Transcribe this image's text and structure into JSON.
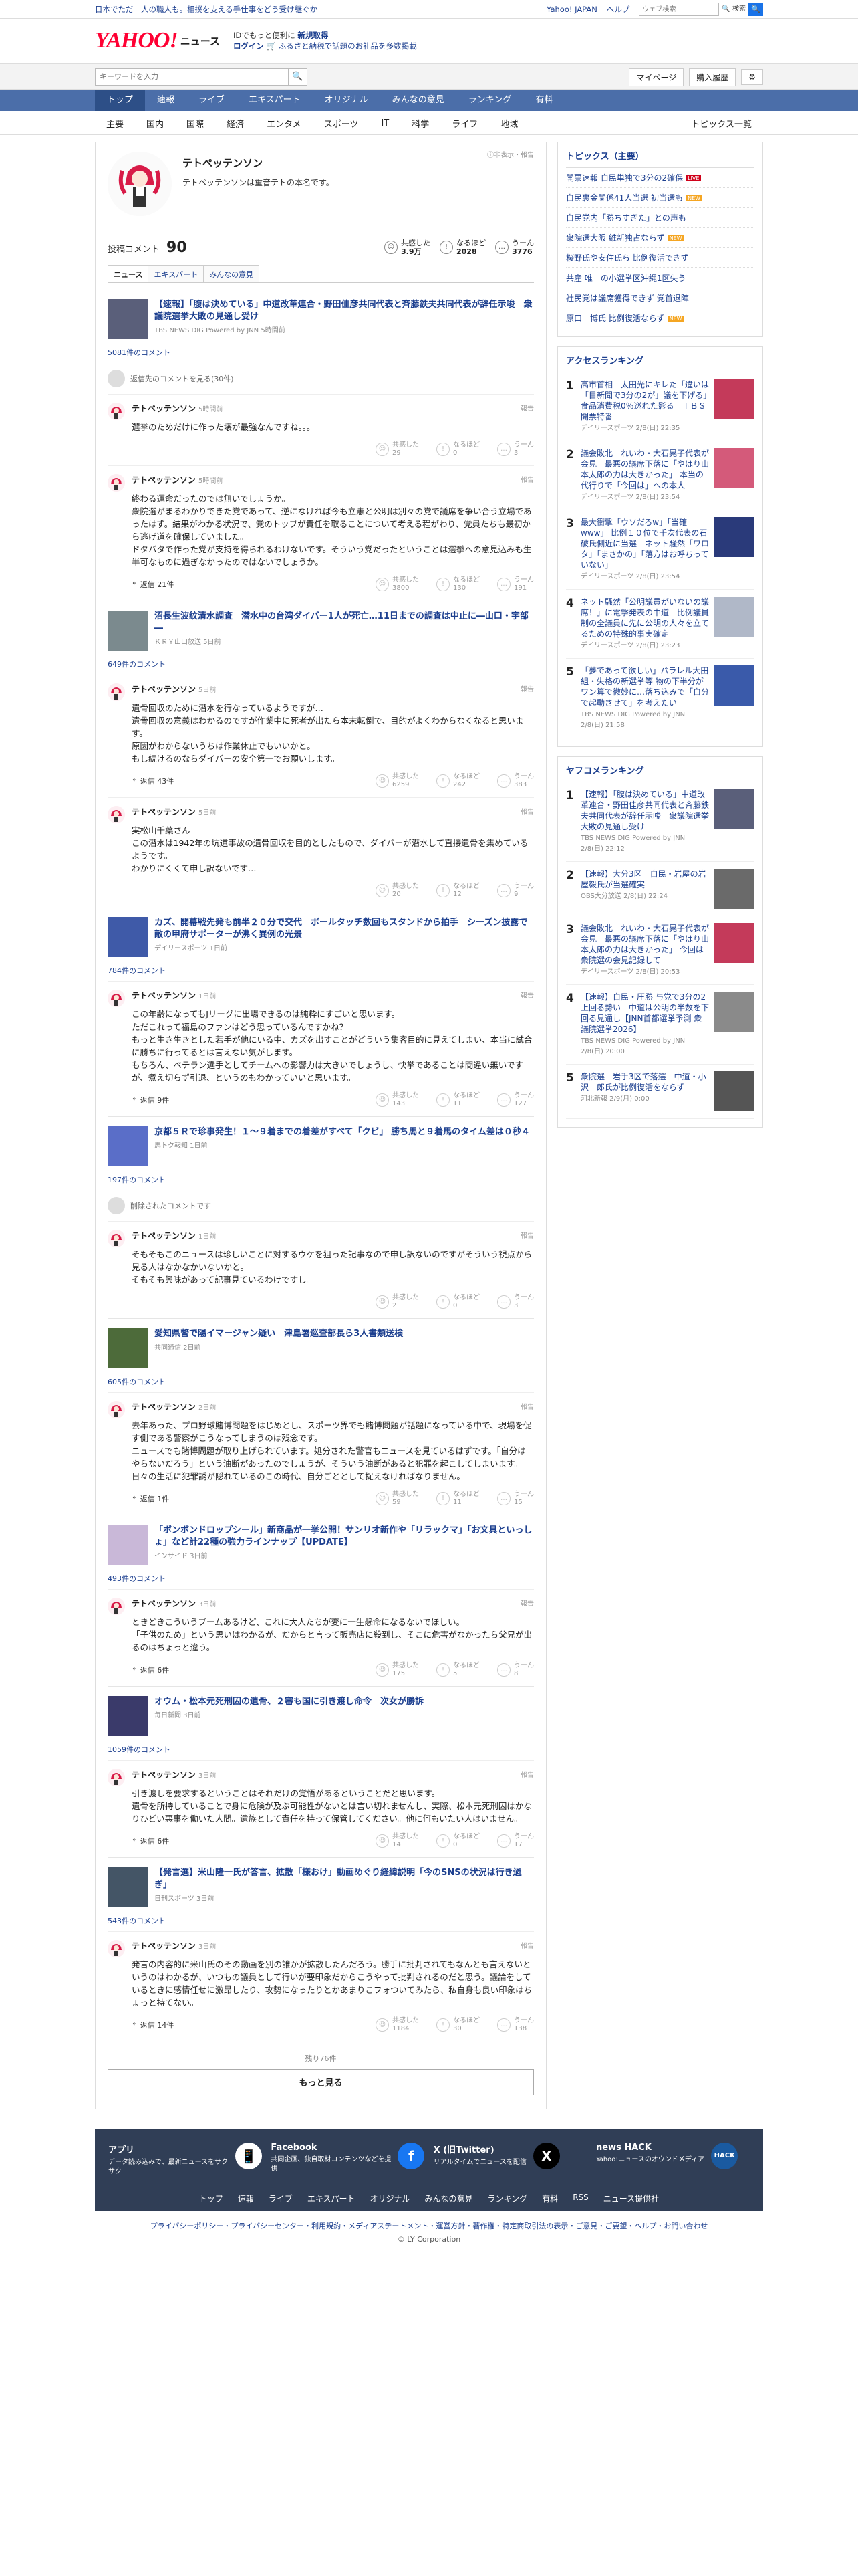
{
  "promo": {
    "left": "日本でただ一人の職人も。相撲を支える手仕事をどう受け継ぐか",
    "links": [
      "Yahoo! JAPAN",
      "ヘルプ"
    ],
    "search_placeholder": "ウェブ検索",
    "search_label": "🔍 検索"
  },
  "header": {
    "logo": "YAHOO!",
    "logo_sub": "ニュース",
    "msg1": "IDでもっと便利に",
    "msg1_bold": "新規取得",
    "msg2": "ログイン",
    "msg2_rest": "🛒 ふるさと納税で話題のお礼品を多数掲載"
  },
  "search": {
    "placeholder": "キーワードを入力",
    "mypage": "マイページ",
    "history": "購入履歴"
  },
  "main_nav": [
    "トップ",
    "速報",
    "ライブ",
    "エキスパート",
    "オリジナル",
    "みんなの意見",
    "ランキング",
    "有料"
  ],
  "cat_nav": [
    "主要",
    "国内",
    "国際",
    "経済",
    "エンタメ",
    "スポーツ",
    "IT",
    "科学",
    "ライフ",
    "地域",
    "トピックス一覧"
  ],
  "profile": {
    "name": "テトペッテンソン",
    "bio": "テトペッテンソンは重音テトの本名です。",
    "report": "ⓘ非表示・報告",
    "comments_label": "投稿コメント",
    "comments_count": "90",
    "reactions": [
      {
        "label": "共感した",
        "value": "3.9万",
        "icon": "☺"
      },
      {
        "label": "なるほど",
        "value": "2028",
        "icon": "!"
      },
      {
        "label": "うーん",
        "value": "3776",
        "icon": "…"
      }
    ],
    "tabs": [
      "ニュース",
      "エキスパート",
      "みんなの意見"
    ]
  },
  "blocks": [
    {
      "title": "【速報】「腹は決めている」中道改革連合・野田佳彦共同代表と斉藤鉄夫共同代表が辞任示唆　衆議院選挙大敗の見通し受け",
      "source": "TBS NEWS DIG Powered by JNN 5時間前",
      "comment_count": "5081件のコメント",
      "thumb_color": "#5a5f7a",
      "hidden": "返信先のコメントを見る(30件)",
      "comments": [
        {
          "name": "テトペッテンソン",
          "time": "5時間前",
          "text": "選挙のためだけに作った壊が最強なんですね。。。",
          "reply": "",
          "r": [
            "29",
            "0",
            "3"
          ]
        },
        {
          "name": "テトペッテンソン",
          "time": "5時間前",
          "text": "終わる運命だったのでは無いでしょうか。\n衆院選がまるわかりできた党であって、逆になければ今も立憲と公明は別々の党で議席を争い合う立場であったはず。結果がわかる状況で、党のトップが責任を取ることについて考える程がわり、党員たちも最初から逃げ道を確保していました。\nドタバタで作った党が支持を得られるわけないです。そういう党だったということは選挙への意見込みも生半可なものに過ぎなかったのではないでしょうか。",
          "reply": "返信 21件",
          "r": [
            "3800",
            "130",
            "191"
          ]
        }
      ]
    },
    {
      "title": "沼長生波紋清水調査　潜水中の台湾ダイバー1人が死亡…11日までの調査は中止に―山口・宇部―",
      "source": "ＫＲＹ山口放送 5日前",
      "comment_count": "649件のコメント",
      "thumb_color": "#7b8a8e",
      "hidden": "",
      "comments": [
        {
          "name": "テトペッテンソン",
          "time": "5日前",
          "text": "遺骨回収のために潜水を行なっているようですが…\n遺骨回収の意義はわかるのですが作業中に死者が出たら本末転倒で、目的がよくわからなくなると思います。\n原因がわからないうちは作業休止でもいいかと。\nもし続けるのならダイバーの安全第一でお願いします。",
          "reply": "返信 43件",
          "r": [
            "6259",
            "242",
            "383"
          ]
        },
        {
          "name": "テトペッテンソン",
          "time": "5日前",
          "text": "実松山千葉さん\nこの潜水は1942年の坑道事故の遺骨回収を目的としたもので、ダイバーが潜水して直接遺骨を集めているようです。\nわかりにくくて申し訳ないです…",
          "reply": "",
          "r": [
            "20",
            "12",
            "9"
          ]
        }
      ]
    },
    {
      "title": "カズ、開幕戦先発も前半２０分で交代　ボールタッチ数回もスタンドから拍手　シーズン披露で敵の甲府サポーターが沸く異例の光景",
      "source": "デイリースポーツ 1日前",
      "comment_count": "784件のコメント",
      "thumb_color": "#3f5aa8",
      "hidden": "",
      "comments": [
        {
          "name": "テトペッテンソン",
          "time": "1日前",
          "text": "この年齢になってもJリーグに出場できるのは純粋にすごいと思います。\nただこれって福島のファンはどう思っているんですかね？\nもっと生き生きとした若手が他にいる中、カズを出すことがどういう集客目的に見えてしまい、本当に試合に勝ちに行ってるとは言えない気がします。\nもちろん、ベテラン選手としてチームへの影響力は大きいでしょうし、快挙であることは間違い無いですが、煮え切らず引退、というのもわかっていいと思います。",
          "reply": "返信 9件",
          "r": [
            "143",
            "11",
            "127"
          ]
        }
      ]
    },
    {
      "title": "京都５Ｒで珍事発生！１～９着までの着差がすべて「クビ」 勝ち馬と９着馬のタイム差は０秒４",
      "source": "馬トク報知 1日前",
      "comment_count": "197件のコメント",
      "thumb_color": "#5a6ec8",
      "hidden": "削除されたコメントです",
      "comments": [
        {
          "name": "テトペッテンソン",
          "time": "1日前",
          "text": "そもそもこのニュースは珍しいことに対するウケを狙った記事なので申し訳ないのですがそういう視点から見る人はなかなかいないかと。\nそもそも興味があって記事見ているわけですし。",
          "reply": "",
          "r": [
            "2",
            "0",
            "3"
          ]
        }
      ]
    },
    {
      "title": "愛知県警で陽イマージャン疑い　津島署巡査部長ら3人書類送検",
      "source": "共同通信 2日前",
      "comment_count": "605件のコメント",
      "thumb_color": "#4d6b3a",
      "hidden": "",
      "comments": [
        {
          "name": "テトペッテンソン",
          "time": "2日前",
          "text": "去年あった、プロ野球賭博問題をはじめとし、スポーツ界でも賭博問題が話題になっている中で、現場を促す側である警察がこうなってしまうのは残念です。\nニュースでも賭博問題が取り上げられています。処分された警官もニュースを見ているはずです。「自分はやらないだろう」という油断があったのでしょうが、そういう油断があると犯罪を起こしてしまいます。日々の生活に犯罪誘が隠れているのこの時代、自分ごととして捉えなければなりません。",
          "reply": "返信 1件",
          "r": [
            "59",
            "11",
            "15"
          ]
        }
      ]
    },
    {
      "title": "「ボンボンドロップシール」新商品が一挙公開！サンリオ新作や「リラックマ」「お文具といっしょ」など計22種の強力ラインナップ【UPDATE】",
      "source": "インサイド 3日前",
      "comment_count": "493件のコメント",
      "thumb_color": "#c9b8d8",
      "hidden": "",
      "comments": [
        {
          "name": "テトペッテンソン",
          "time": "3日前",
          "text": "ときどきこういうブームあるけど、これに大人たちが変に一生懸命になるないでほしい。\n「子供のため」という思いはわかるが、だからと言って販売店に殺到し、そこに危害がなかったら父兄が出るのはちょっと違う。",
          "reply": "返信 6件",
          "r": [
            "175",
            "5",
            "8"
          ]
        }
      ]
    },
    {
      "title": "オウム・松本元死刑囚の遺骨、２審も国に引き渡し命令　次女が勝訴",
      "source": "毎日新聞 3日前",
      "comment_count": "1059件のコメント",
      "thumb_color": "#3a3a6a",
      "hidden": "",
      "comments": [
        {
          "name": "テトペッテンソン",
          "time": "3日前",
          "text": "引き渡しを要求するということはそれだけの覚悟があるということだと思います。\n遺骨を所持していることで身に危険が及ぶ可能性がないとは言い切れませんし、実際、松本元死刑囚はかなりひどい悪事を働いた人間。遺族として責任を持って保管してください。他に何もいたい人はいません。",
          "reply": "返信 6件",
          "r": [
            "14",
            "0",
            "17"
          ]
        }
      ]
    },
    {
      "title": "【発言選】米山隆一氏が答言、拡散「様おけ」動画めぐり経緯説明「今のSNSの状況は行き過ぎ」",
      "source": "日刊スポーツ 3日前",
      "comment_count": "543件のコメント",
      "thumb_color": "#445566",
      "hidden": "",
      "comments": [
        {
          "name": "テトペッテンソン",
          "time": "3日前",
          "text": "発言の内容的に米山氏のその動画を別の誰かが拡散したんだろう。勝手に批判されてもなんとも言えないというのはわかるが、いつもの議員として行いが要印象だからこうやって批判されるのだと思う。議論をしているときに感情任せに激昂したり、攻勢になったりとかあまりこフォついてみたら、私自身も良い印象はちょっと持てない。",
          "reply": "返信 14件",
          "r": [
            "1184",
            "30",
            "138"
          ]
        }
      ]
    }
  ],
  "more_count": "残り76件",
  "more_button": "もっと見る",
  "sidebar": {
    "topics_header": "トピックス（主要）",
    "topics": [
      {
        "t": "開票速報 自民単独で3分の2確保",
        "b": "LIVE",
        "c": "#d0021b"
      },
      {
        "t": "自民裏金関係41人当選 初当選も",
        "b": "NEW",
        "c": "#f5a623"
      },
      {
        "t": "自民党内「勝ちすぎた」との声も",
        "b": "",
        "c": ""
      },
      {
        "t": "衆院選大阪 維新独占ならず",
        "b": "NEW",
        "c": "#f5a623"
      },
      {
        "t": "桜野氏や安住氏ら 比例復活できず",
        "b": "",
        "c": ""
      },
      {
        "t": "共産 唯一の小選挙区沖縄1区失う",
        "b": "",
        "c": ""
      },
      {
        "t": "社民党は議席獲得できず 党首退陣",
        "b": "",
        "c": ""
      },
      {
        "t": "原口一博氏 比例復活ならず",
        "b": "NEW",
        "c": "#f5a623"
      }
    ],
    "access_header": "アクセスランキング",
    "access": [
      {
        "t": "高市首相　太田光にキレた「違いは「目新聞で3分の2が」議を下げる」食品消費税0％巡れた影る　ＴＢＳ開票特番",
        "s": "デイリースポーツ 2/8(日) 22:35",
        "c": "#c43a5a"
      },
      {
        "t": "議会敗北　れいわ・大石晃子代表が会見　最悪の議席下落に「やはり山本太郎の力は大きかった」 本当の代行りで「今回は」への本人",
        "s": "デイリースポーツ 2/8(日) 23:54",
        "c": "#d45a7a"
      },
      {
        "t": "最大衝撃「ウソだろw」「当確www」 比例１０位で千次代表の石破氏側近に当選　ネット騒然「ワロタ」「まさかの」「落方はお呼ちっていない」",
        "s": "デイリースポーツ 2/8(日) 23:54",
        "c": "#2a3a7a"
      },
      {
        "t": "ネット騒然「公明議員がいないの議席！」に電撃発表の中道　比例議員制の全議員に先に公明の人々を立てるための特殊的事実確定",
        "s": "デイリースポーツ 2/8(日) 23:23",
        "c": "#b0b8c8"
      },
      {
        "t": "「夢であって欲しい」パラレル大田組・失格の新選挙等 物の下半分がワン算で微妙に…落ち込みで「自分で起動させて」を考えたい",
        "s": "TBS NEWS DIG Powered by JNN 2/8(日) 21:58",
        "c": "#3a5aaa"
      }
    ],
    "yahoo_header": "ヤフコメランキング",
    "yahoo": [
      {
        "t": "【速報】「腹は決めている」中道改革連合・野田佳彦共同代表と斉藤鉄夫共同代表が辞任示唆　衆議院選挙大敗の見通し受け",
        "s": "TBS NEWS DIG Powered by JNN 2/8(日) 22:12",
        "c": "#5a5f7a"
      },
      {
        "t": "【速報】大分3区　自民・岩屋の岩屋毅氏が当選確実",
        "s": "OBS大分放送 2/8(日) 22:24",
        "c": "#6a6a6a"
      },
      {
        "t": "議会敗北　れいわ・大石晃子代表が会見　最悪の議席下落に「やはり山本太郎の力は大きかった」 今回は衆院選の会見記録して",
        "s": "デイリースポーツ 2/8(日) 20:53",
        "c": "#c43a5a"
      },
      {
        "t": "【速報】自民・圧勝 与党で3分の2上回る勢い　中道は公明の半数を下回る見通し【JNN首都選挙予測 衆議院選挙2026】",
        "s": "TBS NEWS DIG Powered by JNN 2/8(日) 20:00",
        "c": "#8a8a8a"
      },
      {
        "t": "衆院選　岩手3区で落選　中道・小沢一郎氏が比例復活をならず",
        "s": "河北新報 2/9(月) 0:00",
        "c": "#555"
      }
    ]
  },
  "footer": {
    "cells": [
      {
        "title": "アプリ",
        "desc": "データ読み込みで、最新ニュースをサクサク",
        "icon": "📱",
        "bg": "#ffffff",
        "fg": "#333"
      },
      {
        "title": "Facebook",
        "desc": "共同企画、独自取材コンテンツなどを提供",
        "icon": "f",
        "bg": "#1877f2",
        "fg": "#fff"
      },
      {
        "title": "X (旧Twitter)",
        "desc": "リアルタイムでニュースを配信",
        "icon": "X",
        "bg": "#000000",
        "fg": "#fff"
      },
      {
        "title": "news HACK",
        "desc": "Yahoo!ニュースのオウンドメディア",
        "icon": "HACK",
        "bg": "#1a5aa0",
        "fg": "#fff"
      }
    ],
    "links": [
      "トップ",
      "速報",
      "ライブ",
      "エキスパート",
      "オリジナル",
      "みんなの意見",
      "ランキング",
      "有料",
      "RSS",
      "ニュース提供社"
    ],
    "legal": "プライバシーポリシー・プライバシーセンター・利用規約・メディアステートメント・運営方針・著作権・特定商取引法の表示・ご意見・ご要望・ヘルプ・お問い合わせ",
    "copy": "© LY Corporation"
  }
}
